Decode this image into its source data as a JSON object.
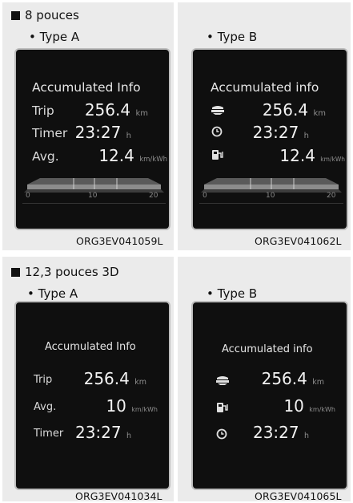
{
  "section1": {
    "heading": "8 pouces",
    "panelA": {
      "type_label": "• Type A",
      "title": "Accumulated Info",
      "rows": [
        {
          "label": "Trip",
          "value": "256.4",
          "unit": "km"
        },
        {
          "label": "Timer",
          "value": "23:27",
          "unit": "h"
        },
        {
          "label": "Avg.",
          "value": "12.4",
          "unit": "km/kWh"
        }
      ],
      "scale": [
        "0",
        "10",
        "20"
      ],
      "code": "ORG3EV041059L"
    },
    "panelB": {
      "type_label": "• Type B",
      "title": "Accumulated info",
      "rows": [
        {
          "icon": "trip-icon",
          "value": "256.4",
          "unit": "km"
        },
        {
          "icon": "clock-icon",
          "value": "23:27",
          "unit": "h"
        },
        {
          "icon": "fuel-icon",
          "value": "12.4",
          "unit": "km/kWh"
        }
      ],
      "scale": [
        "0",
        "10",
        "20"
      ],
      "code": "ORG3EV041062L"
    }
  },
  "section2": {
    "heading": "12,3 pouces 3D",
    "panelA": {
      "type_label": "• Type A",
      "title": "Accumulated Info",
      "rows": [
        {
          "label": "Trip",
          "value": "256.4",
          "unit": "km"
        },
        {
          "label": "Avg.",
          "value": "10",
          "unit": "km/kWh"
        },
        {
          "label": "Timer",
          "value": "23:27",
          "unit": "h"
        }
      ],
      "code": "ORG3EV041034L"
    },
    "panelB": {
      "type_label": "• Type B",
      "title": "Accumulated info",
      "rows": [
        {
          "icon": "trip-icon",
          "value": "256.4",
          "unit": "km"
        },
        {
          "icon": "fuel-icon",
          "value": "10",
          "unit": "km/kWh"
        },
        {
          "icon": "clock-icon",
          "value": "23:27",
          "unit": "h"
        }
      ],
      "code": "ORG3EV041065L"
    }
  }
}
